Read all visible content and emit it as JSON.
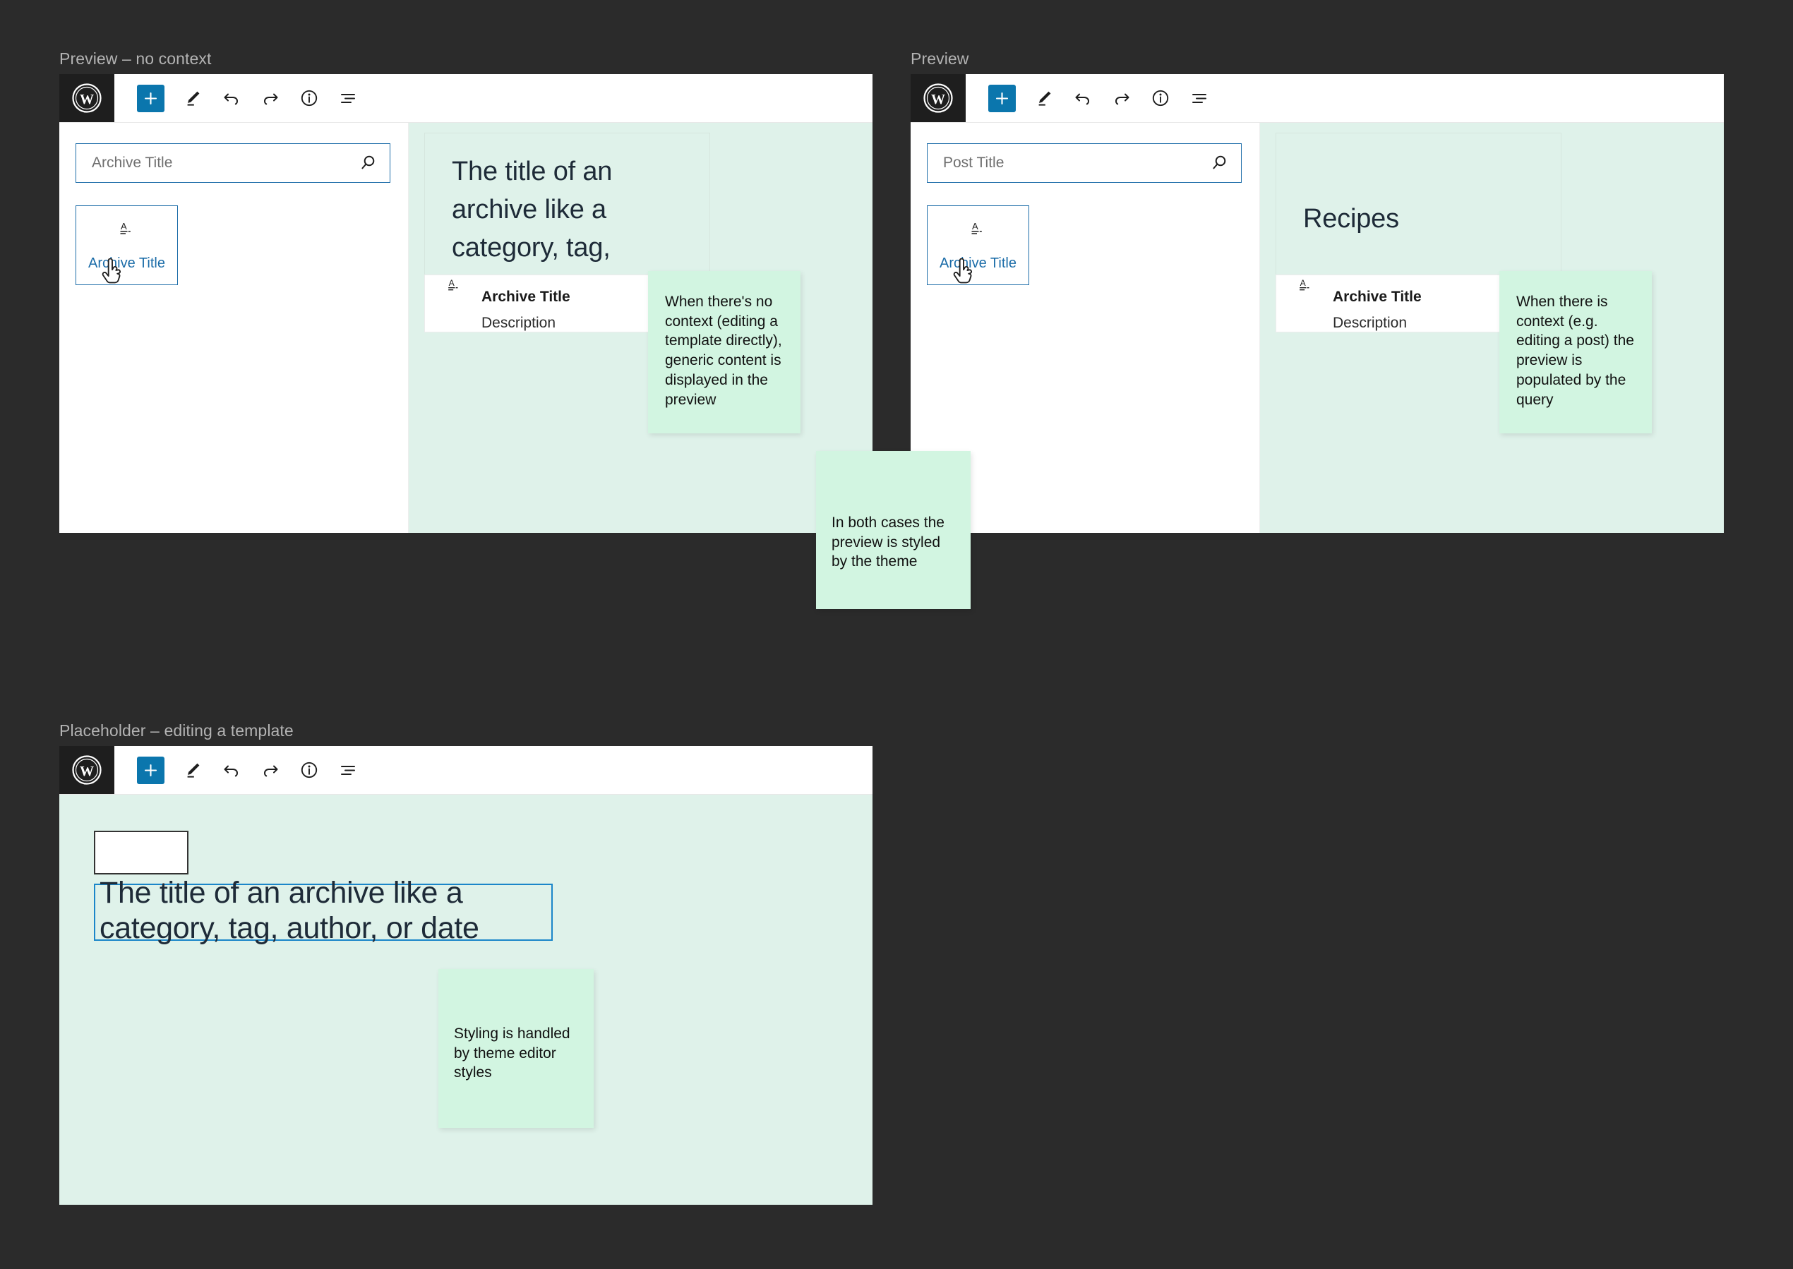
{
  "canvas": {
    "background": "#2b2b2b"
  },
  "colors": {
    "dark_bg": "#2b2b2b",
    "accent_blue": "#0b76ad",
    "link_blue": "#1b6ca8",
    "preview_green": "#dff2ea",
    "sticky_green": "#d2f5e1",
    "logo_bg": "#1e1e1e"
  },
  "toolbar": {
    "add_label": "+",
    "icons": [
      {
        "name": "add-block-icon",
        "label": "+"
      },
      {
        "name": "edit-pencil-icon",
        "label": ""
      },
      {
        "name": "undo-icon",
        "label": ""
      },
      {
        "name": "redo-icon",
        "label": ""
      },
      {
        "name": "info-icon",
        "label": ""
      },
      {
        "name": "list-view-icon",
        "label": ""
      }
    ]
  },
  "panels": {
    "preview_no_context": {
      "label": "Preview – no context",
      "search": {
        "placeholder": "Archive Title",
        "value": ""
      },
      "inserter_card": {
        "label": "Archive Title",
        "icon": "archive-title-block-icon"
      },
      "preview": {
        "title": "The title of an archive like a category, tag, author, or date",
        "meta": {
          "name": "Archive Title",
          "description": "Description",
          "icon": "archive-title-block-icon"
        }
      },
      "note": "When there's no context (editing a template directly), generic content is displayed in the preview"
    },
    "preview_with_context": {
      "label": "Preview",
      "search": {
        "placeholder": "Post Title",
        "value": ""
      },
      "inserter_card": {
        "label": "Archive Title",
        "icon": "archive-title-block-icon"
      },
      "preview": {
        "title": "Recipes",
        "meta": {
          "name": "Archive Title",
          "description": "Description",
          "icon": "archive-title-block-icon"
        }
      },
      "note": "When there is context (e.g. editing a post) the preview is populated by the query"
    },
    "placeholder_editing_template": {
      "label": "Placeholder – editing a template",
      "title_block": {
        "text": "The title of an archive like a category, tag, author, or date"
      },
      "note": "Styling is handled by theme editor styles"
    }
  },
  "shared_note": "In both cases the preview is styled by the theme"
}
